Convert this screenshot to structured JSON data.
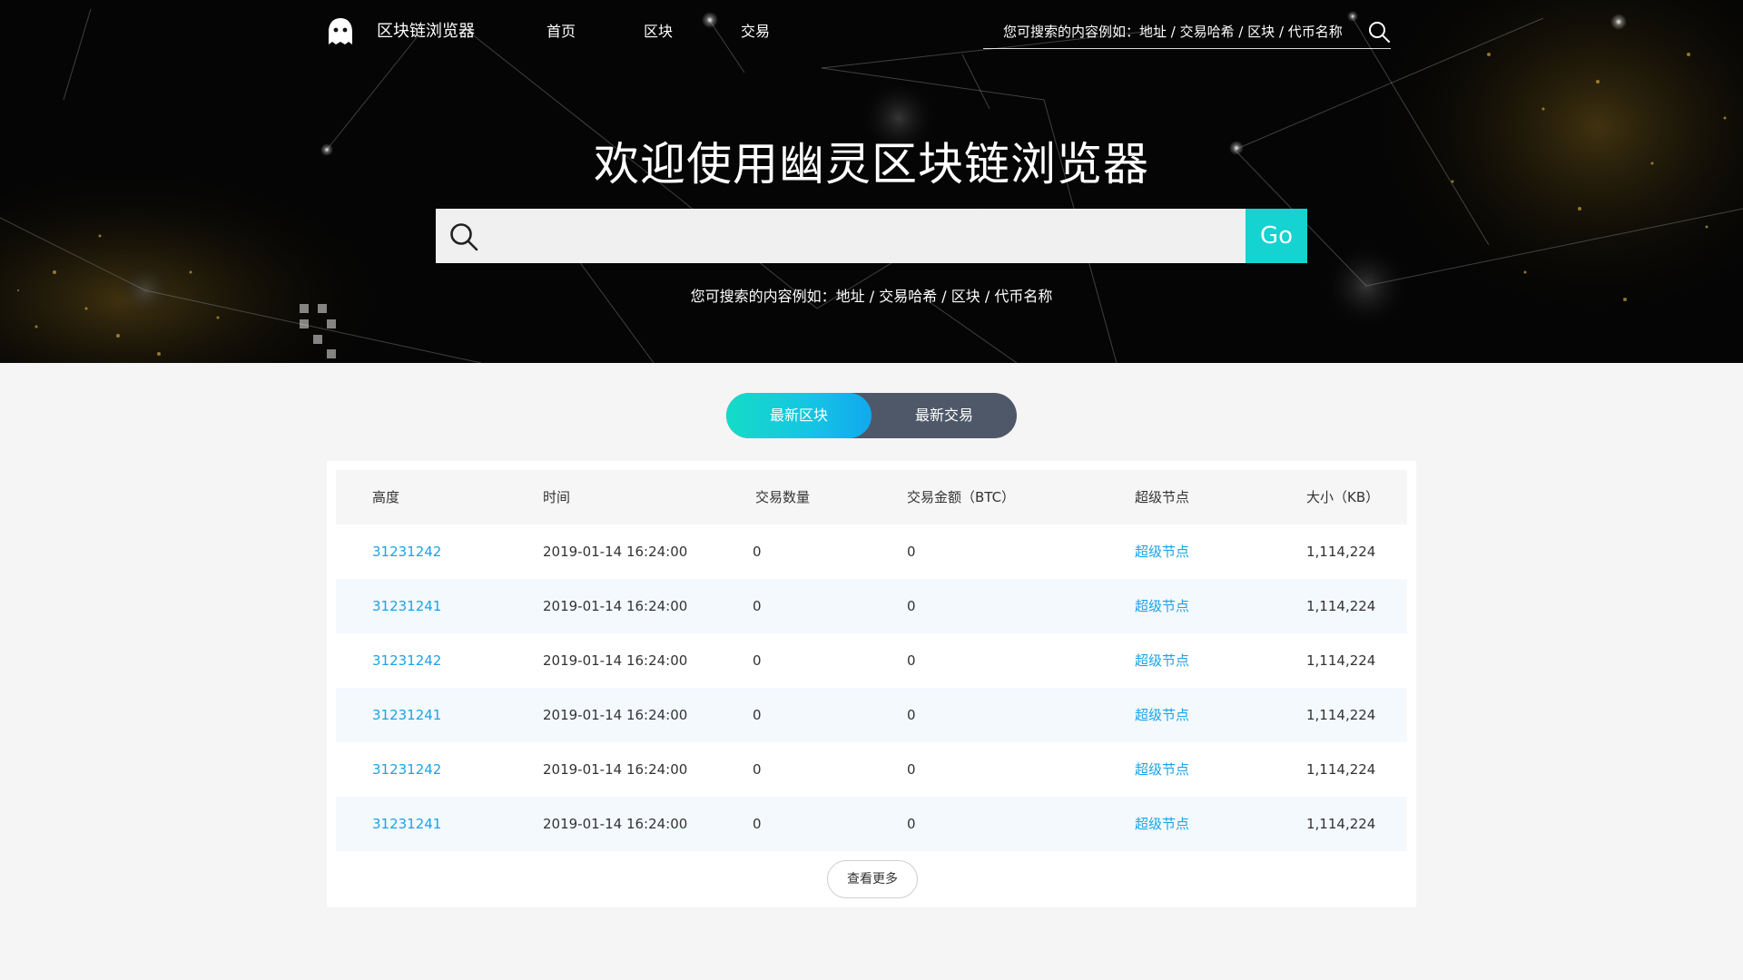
{
  "brand": {
    "name": "区块链浏览器",
    "logo_icon": "ghost-icon"
  },
  "nav": {
    "items": [
      {
        "label": "首页"
      },
      {
        "label": "区块"
      },
      {
        "label": "交易"
      }
    ]
  },
  "top_search": {
    "placeholder": "您可搜索的内容例如：地址 / 交易哈希 / 区块 / 代币名称",
    "icon": "search-icon"
  },
  "hero": {
    "title": "欢迎使用幽灵区块链浏览器",
    "search_value": "",
    "go_label": "Go",
    "hint": "您可搜索的内容例如：地址 / 交易哈希 / 区块 / 代币名称"
  },
  "tabs": {
    "items": [
      {
        "label": "最新区块",
        "active": true
      },
      {
        "label": "最新交易",
        "active": false
      }
    ]
  },
  "table": {
    "columns": [
      "高度",
      "时间",
      "交易数量",
      "交易金额（BTC）",
      "超级节点",
      "大小（KB）"
    ],
    "rows": [
      {
        "height": "31231242",
        "time": "2019-01-14 16:24:00",
        "tx_count": "0",
        "amount": "0",
        "node": "超级节点",
        "size": "1,114,224"
      },
      {
        "height": "31231241",
        "time": "2019-01-14 16:24:00",
        "tx_count": "0",
        "amount": "0",
        "node": "超级节点",
        "size": "1,114,224"
      },
      {
        "height": "31231242",
        "time": "2019-01-14 16:24:00",
        "tx_count": "0",
        "amount": "0",
        "node": "超级节点",
        "size": "1,114,224"
      },
      {
        "height": "31231241",
        "time": "2019-01-14 16:24:00",
        "tx_count": "0",
        "amount": "0",
        "node": "超级节点",
        "size": "1,114,224"
      },
      {
        "height": "31231242",
        "time": "2019-01-14 16:24:00",
        "tx_count": "0",
        "amount": "0",
        "node": "超级节点",
        "size": "1,114,224"
      },
      {
        "height": "31231241",
        "time": "2019-01-14 16:24:00",
        "tx_count": "0",
        "amount": "0",
        "node": "超级节点",
        "size": "1,114,224"
      }
    ],
    "more_label": "查看更多"
  },
  "colors": {
    "accent": "#14d3d0",
    "link": "#1aa3e8",
    "tab_inactive": "#4f5868",
    "row_alt": "#f4f9fe"
  }
}
